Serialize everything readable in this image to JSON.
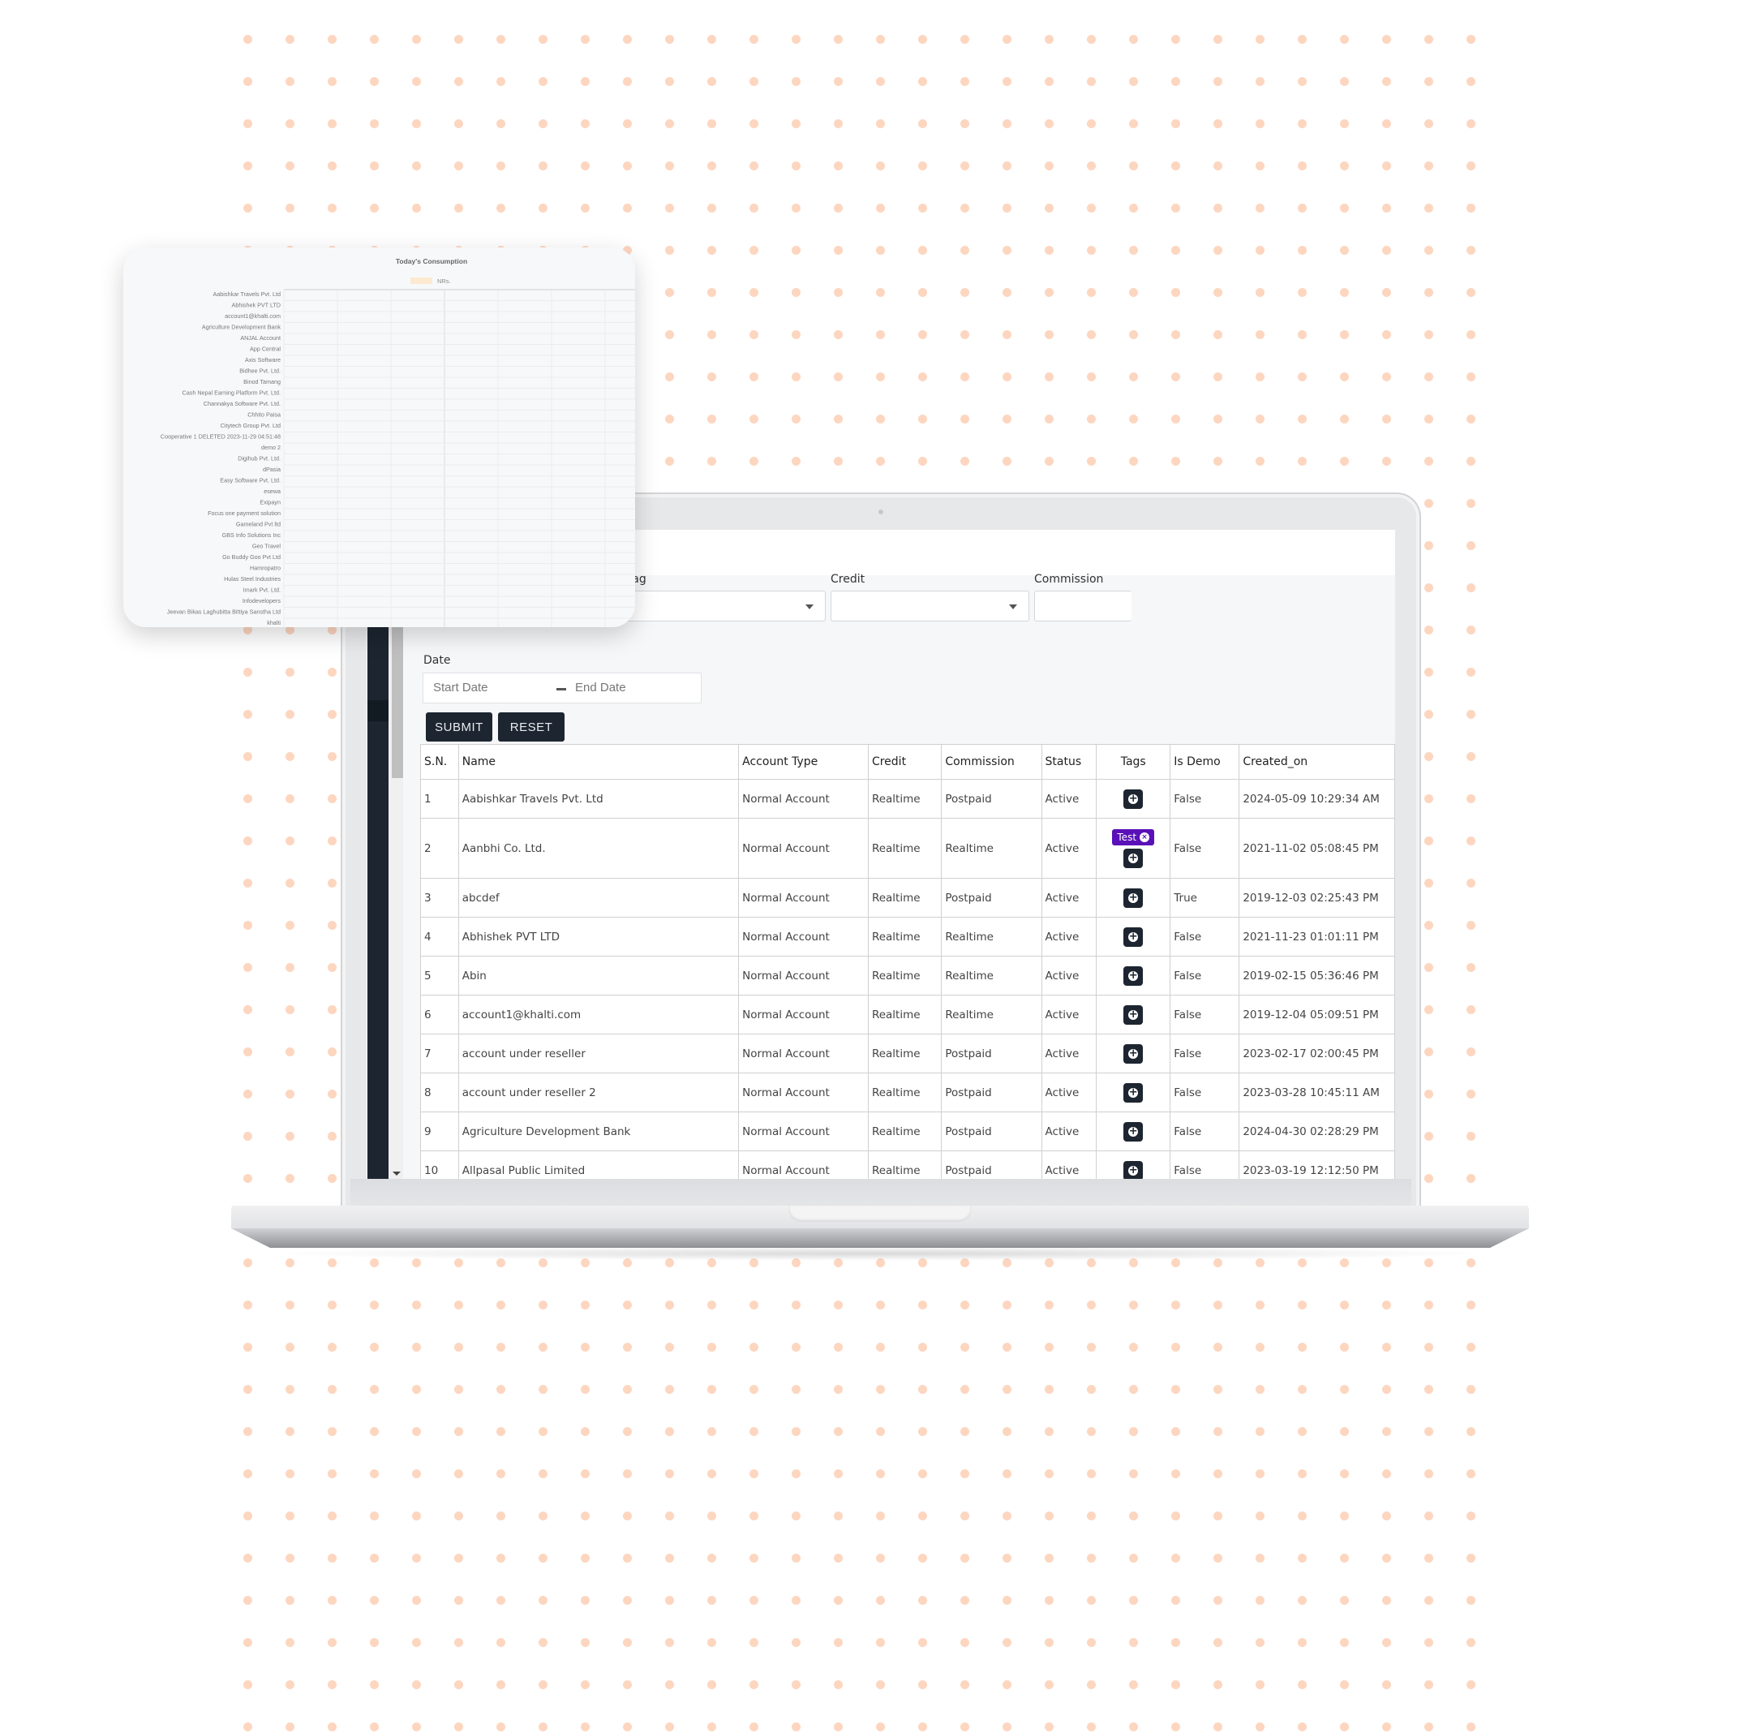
{
  "background": {
    "dot_color": "#FDD6C0"
  },
  "filters": {
    "tag_label": "Tag",
    "credit_label": "Credit",
    "commission_label": "Commission",
    "date_label": "Date",
    "start_date_placeholder": "Start Date",
    "end_date_placeholder": "End Date",
    "tag_value": "",
    "credit_value": "",
    "commission_value": ""
  },
  "buttons": {
    "submit": "SUBMIT",
    "reset": "RESET"
  },
  "table": {
    "headers": [
      "S.N.",
      "Name",
      "Account Type",
      "Credit",
      "Commission",
      "Status",
      "Tags",
      "Is Demo",
      "Created_on"
    ],
    "rows": [
      {
        "sn": "1",
        "name": "Aabishkar Travels Pvt. Ltd",
        "account_type": "Normal Account",
        "credit": "Realtime",
        "commission": "Postpaid",
        "status": "Active",
        "tags": [],
        "is_demo": "False",
        "created_on": "2024-05-09 10:29:34 AM"
      },
      {
        "sn": "2",
        "name": "Aanbhi Co. Ltd.",
        "account_type": "Normal Account",
        "credit": "Realtime",
        "commission": "Realtime",
        "status": "Active",
        "tags": [
          "Test"
        ],
        "is_demo": "False",
        "created_on": "2021-11-02 05:08:45 PM"
      },
      {
        "sn": "3",
        "name": "abcdef",
        "account_type": "Normal Account",
        "credit": "Realtime",
        "commission": "Postpaid",
        "status": "Active",
        "tags": [],
        "is_demo": "True",
        "created_on": "2019-12-03 02:25:43 PM"
      },
      {
        "sn": "4",
        "name": "Abhishek PVT LTD",
        "account_type": "Normal Account",
        "credit": "Realtime",
        "commission": "Realtime",
        "status": "Active",
        "tags": [],
        "is_demo": "False",
        "created_on": "2021-11-23 01:01:11 PM"
      },
      {
        "sn": "5",
        "name": "Abin",
        "account_type": "Normal Account",
        "credit": "Realtime",
        "commission": "Realtime",
        "status": "Active",
        "tags": [],
        "is_demo": "False",
        "created_on": "2019-02-15 05:36:46 PM"
      },
      {
        "sn": "6",
        "name": "account1@khalti.com",
        "account_type": "Normal Account",
        "credit": "Realtime",
        "commission": "Realtime",
        "status": "Active",
        "tags": [],
        "is_demo": "False",
        "created_on": "2019-12-04 05:09:51 PM"
      },
      {
        "sn": "7",
        "name": "account under reseller",
        "account_type": "Normal Account",
        "credit": "Realtime",
        "commission": "Postpaid",
        "status": "Active",
        "tags": [],
        "is_demo": "False",
        "created_on": "2023-02-17 02:00:45 PM"
      },
      {
        "sn": "8",
        "name": "account under reseller 2",
        "account_type": "Normal Account",
        "credit": "Realtime",
        "commission": "Postpaid",
        "status": "Active",
        "tags": [],
        "is_demo": "False",
        "created_on": "2023-03-28 10:45:11 AM"
      },
      {
        "sn": "9",
        "name": "Agriculture Development Bank",
        "account_type": "Normal Account",
        "credit": "Realtime",
        "commission": "Postpaid",
        "status": "Active",
        "tags": [],
        "is_demo": "False",
        "created_on": "2024-04-30 02:28:29 PM"
      },
      {
        "sn": "10",
        "name": "Allpasal Public Limited",
        "account_type": "Normal Account",
        "credit": "Realtime",
        "commission": "Postpaid",
        "status": "Active",
        "tags": [],
        "is_demo": "False",
        "created_on": "2023-03-19 12:12:50 PM"
      }
    ],
    "tag_color": "#5A10B8",
    "add_tag_icon": "plus-circle-icon",
    "remove_tag_icon": "close-circle-icon"
  },
  "chart_data": {
    "type": "bar",
    "orientation": "horizontal",
    "title": "Today's Consumption",
    "legend": [
      {
        "name": "NRs.",
        "color": "#FCE9CF"
      }
    ],
    "legend_position": "top-center",
    "grid": true,
    "xlabel": "",
    "ylabel": "",
    "categories": [
      "Aabishkar Travels Pvt. Ltd",
      "Abhishek PVT LTD",
      "account1@khalti.com",
      "Agriculture Development Bank",
      "ANJAL Account",
      "App Central",
      "Axis Software",
      "Bidhee Pvt. Ltd.",
      "Binod Tamang",
      "Cash Nepal Earning Platform Pvt. Ltd.",
      "Channakya Software Pvt. Ltd.",
      "Chhito Paisa",
      "Citytech Group Pvt. Ltd",
      "Cooperative 1 DELETED 2023-11-29 04:51:48",
      "demo 2",
      "Digihub Pvt. Ltd.",
      "dPasia",
      "Easy Software Pvt. Ltd.",
      "esewa",
      "Exipayn",
      "Focus one payment solution",
      "Gameland Pvt ltd",
      "GBS Info Solutions Inc",
      "Geo Travel",
      "Go Buddy Goo Pvt Ltd",
      "Hamropatro",
      "Hulas Steel Industries",
      "Imark Pvt. Ltd.",
      "Infodevelopers",
      "Jeevan Bikas Laghubitta Bittiya Sanstha Ltd",
      "khalti"
    ],
    "series": [
      {
        "name": "NRs.",
        "values": [
          0,
          0,
          0,
          0,
          0,
          0,
          0,
          0,
          0,
          0,
          0,
          0,
          0,
          0,
          0,
          0,
          0,
          0,
          0,
          0,
          0,
          0,
          0,
          0,
          0,
          0,
          0,
          0,
          0,
          0,
          0
        ]
      }
    ],
    "x_gridlines": 7
  }
}
